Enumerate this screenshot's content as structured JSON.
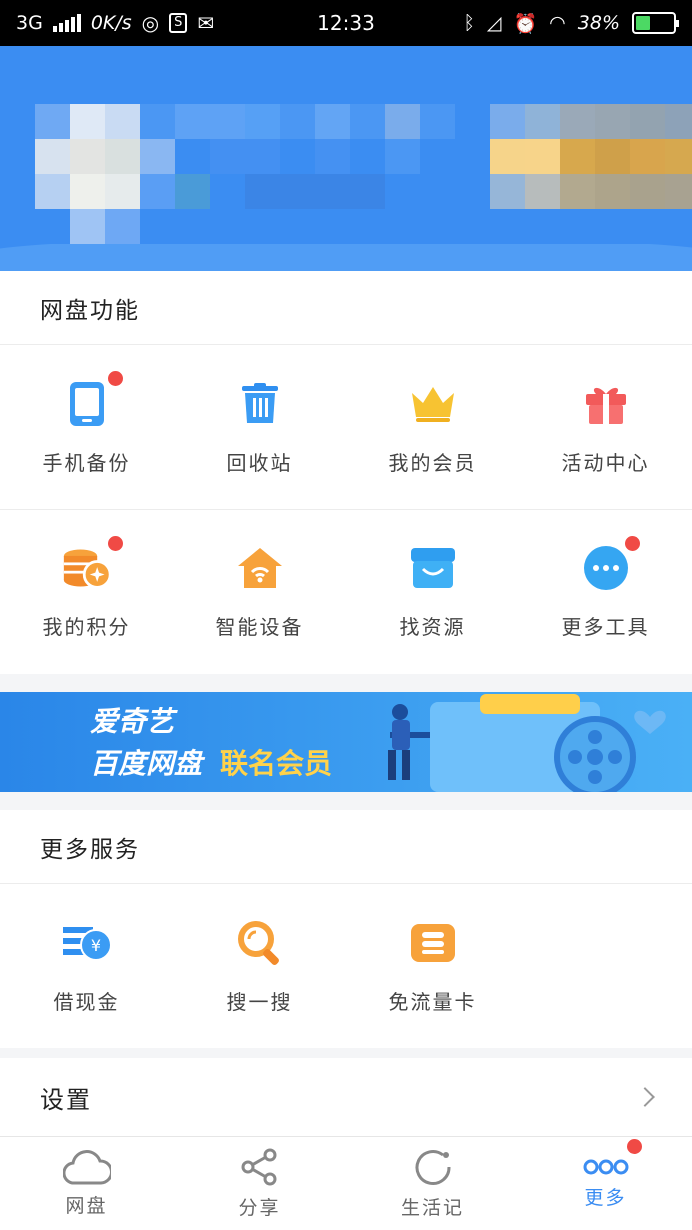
{
  "status_bar": {
    "network": "3G",
    "speed": "0K/s",
    "time": "12:33",
    "battery": "38%",
    "battery_level": 0.38
  },
  "disk_section": {
    "title": "网盘功能",
    "items": [
      {
        "label": "手机备份",
        "icon": "phone-icon",
        "badge": true
      },
      {
        "label": "回收站",
        "icon": "trash-icon",
        "badge": false
      },
      {
        "label": "我的会员",
        "icon": "crown-icon",
        "badge": false
      },
      {
        "label": "活动中心",
        "icon": "gift-icon",
        "badge": false
      },
      {
        "label": "我的积分",
        "icon": "coins-icon",
        "badge": true
      },
      {
        "label": "智能设备",
        "icon": "smart-home-icon",
        "badge": false
      },
      {
        "label": "找资源",
        "icon": "store-icon",
        "badge": false
      },
      {
        "label": "更多工具",
        "icon": "more-dots-icon",
        "badge": true
      }
    ]
  },
  "promo_banner": {
    "line1": "爱奇艺",
    "line2": "百度网盘",
    "highlight": "联名会员"
  },
  "more_services": {
    "title": "更多服务",
    "items": [
      {
        "label": "借现金",
        "icon": "cash-icon"
      },
      {
        "label": "搜一搜",
        "icon": "search-icon"
      },
      {
        "label": "免流量卡",
        "icon": "sim-card-icon"
      }
    ]
  },
  "settings": {
    "label": "设置"
  },
  "tab_bar": {
    "tabs": [
      {
        "label": "网盘",
        "icon": "cloud-icon",
        "active": false
      },
      {
        "label": "分享",
        "icon": "share-icon",
        "active": false
      },
      {
        "label": "生活记",
        "icon": "life-icon",
        "active": false
      },
      {
        "label": "更多",
        "icon": "more-icon",
        "active": true
      }
    ]
  },
  "colors": {
    "brand_blue": "#3b8df2",
    "badge_red": "#f04a45",
    "orange": "#f7a23b"
  }
}
